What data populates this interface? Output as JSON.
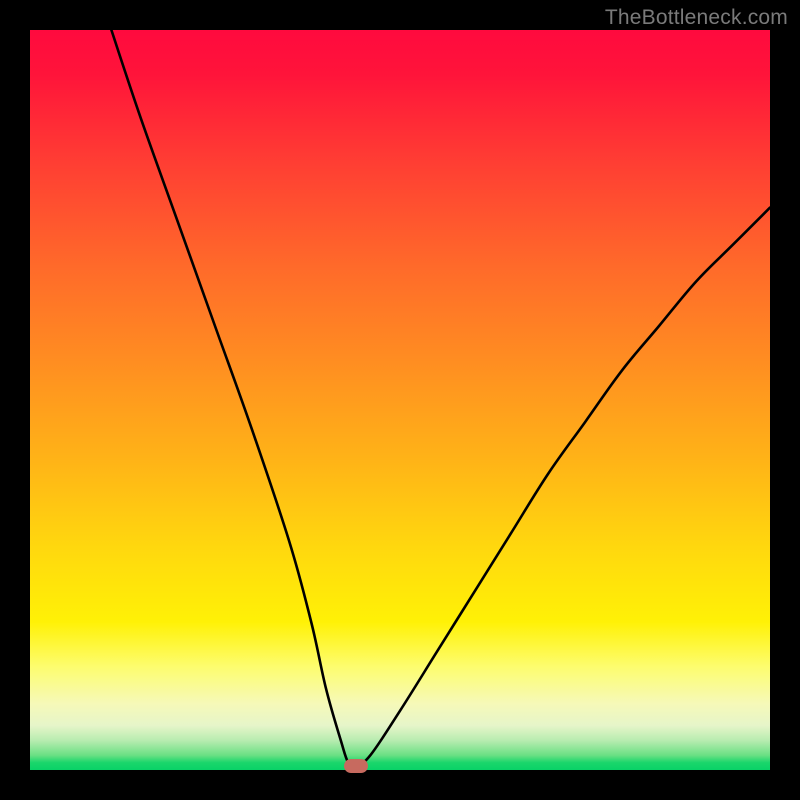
{
  "watermark": "TheBottleneck.com",
  "colors": {
    "frame": "#000000",
    "watermark_text": "#7a7a7a",
    "curve_stroke": "#000000",
    "marker_fill": "#c76a5f",
    "gradient_stops": [
      "#ff0a3e",
      "#ff6a2a",
      "#ffd80e",
      "#fdfd6e",
      "#1ad66b"
    ]
  },
  "chart_data": {
    "type": "line",
    "title": "",
    "xlabel": "",
    "ylabel": "",
    "xlim": [
      0,
      100
    ],
    "ylim": [
      0,
      100
    ],
    "grid": false,
    "legend": false,
    "background": "vertical red→green gradient",
    "series": [
      {
        "name": "curve",
        "x": [
          11,
          15,
          20,
          25,
          30,
          35,
          38,
          40,
          42,
          43,
          44,
          46,
          50,
          55,
          60,
          65,
          70,
          75,
          80,
          85,
          90,
          95,
          100
        ],
        "y": [
          100,
          88,
          74,
          60,
          46,
          31,
          20,
          11,
          4,
          1,
          0.5,
          2,
          8,
          16,
          24,
          32,
          40,
          47,
          54,
          60,
          66,
          71,
          76
        ]
      }
    ],
    "marker": {
      "x": 44,
      "y": 0.5
    },
    "notes": "Plot area occupies ~740×740 px inset in a black 800×800 frame. Curve reaches minimum near x≈44 meeting the green band at the bottom, then rises to ~76 at x=100. No axis ticks or numeric labels are visible."
  }
}
